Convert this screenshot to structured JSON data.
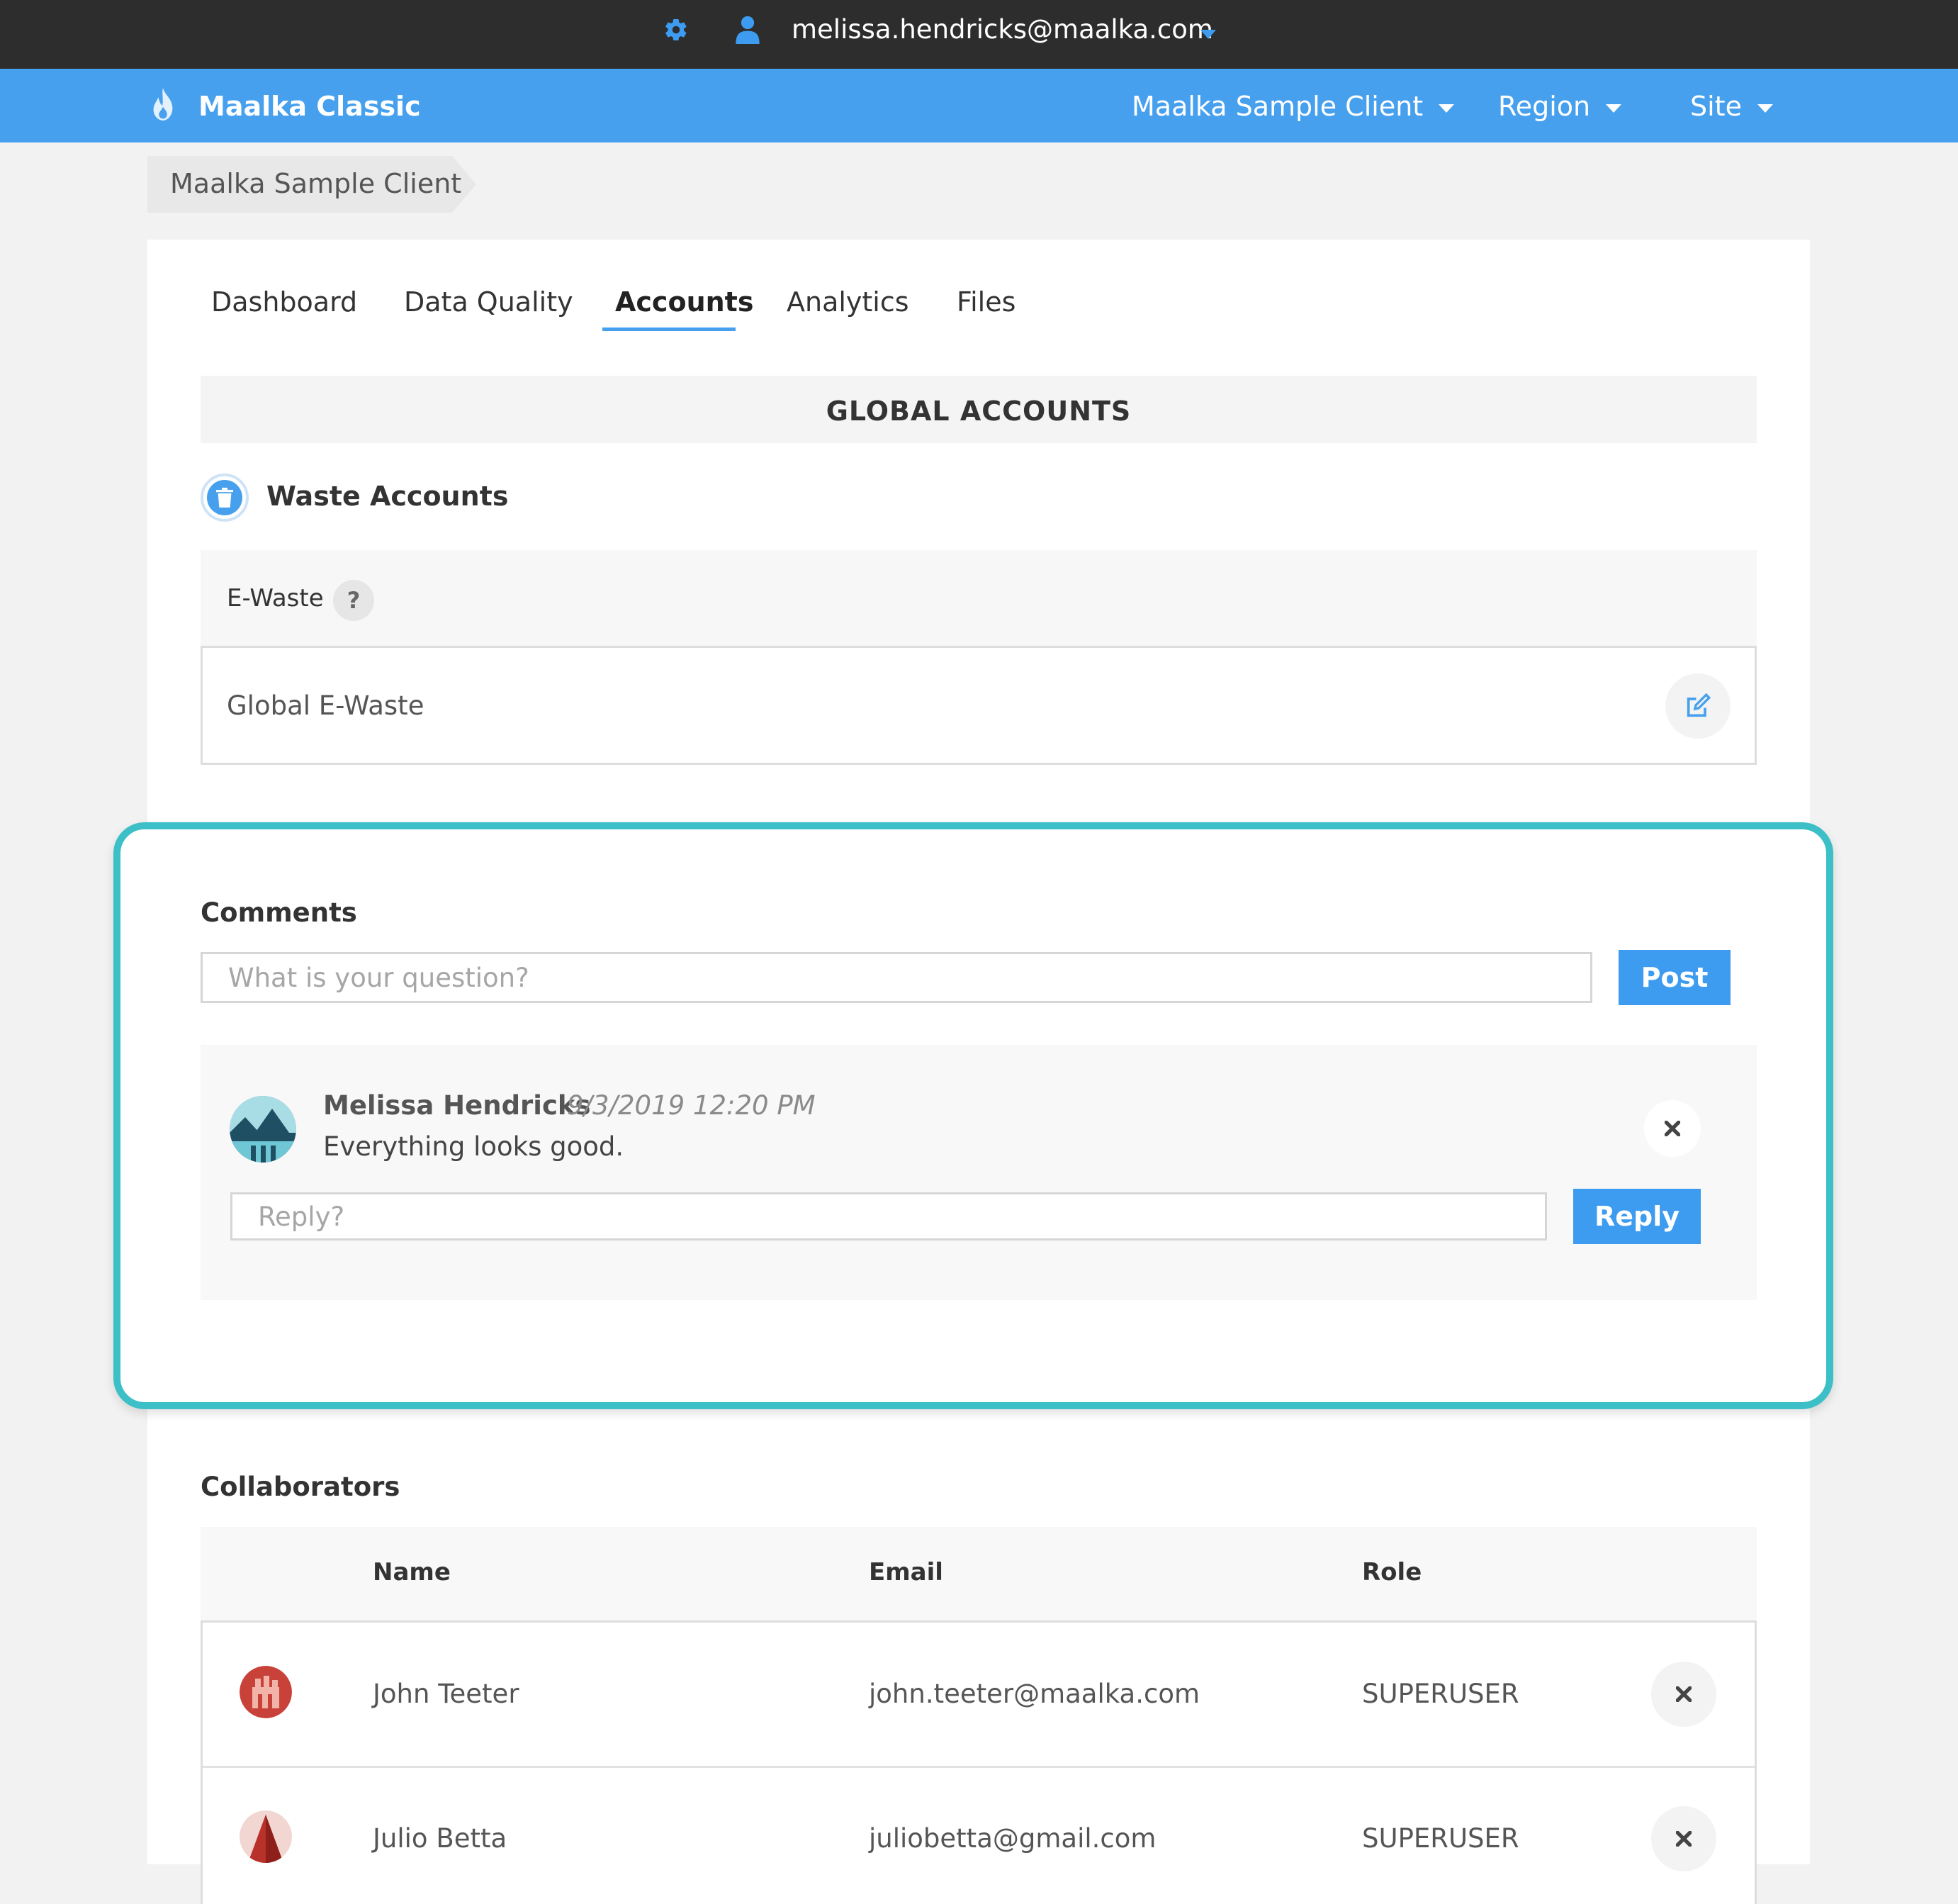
{
  "topbar": {
    "user_email": "melissa.hendricks@maalka.com"
  },
  "appbar": {
    "brand": "Maalka Classic",
    "nav": [
      {
        "label": "Maalka Sample Client"
      },
      {
        "label": "Region"
      },
      {
        "label": "Site"
      }
    ]
  },
  "breadcrumb": {
    "label": "Maalka Sample Client"
  },
  "tabs": [
    {
      "label": "Dashboard",
      "active": false
    },
    {
      "label": "Data Quality",
      "active": false
    },
    {
      "label": "Accounts",
      "active": true
    },
    {
      "label": "Analytics",
      "active": false
    },
    {
      "label": "Files",
      "active": false
    }
  ],
  "global_accounts": {
    "title": "GLOBAL ACCOUNTS",
    "waste_title": "Waste Accounts",
    "ewaste_label": "E-Waste",
    "help_glyph": "?",
    "ewaste_value": "Global E-Waste"
  },
  "comments": {
    "title": "Comments",
    "question_placeholder": "What is your question?",
    "post_label": "Post",
    "items": [
      {
        "author": "Melissa Hendricks",
        "timestamp": "9/3/2019 12:20 PM",
        "text": "Everything looks good.",
        "reply_placeholder": "Reply?",
        "reply_label": "Reply"
      }
    ]
  },
  "collaborators": {
    "title": "Collaborators",
    "columns": [
      "Name",
      "Email",
      "Role"
    ],
    "rows": [
      {
        "name": "John Teeter",
        "email": "john.teeter@maalka.com",
        "role": "SUPERUSER"
      },
      {
        "name": "Julio Betta",
        "email": "juliobetta@gmail.com",
        "role": "SUPERUSER"
      }
    ]
  },
  "colors": {
    "topbar": "#2d2d2d",
    "appbar": "#46a0ee",
    "accent": "#3d9bf0",
    "highlight": "#3cbfc6"
  },
  "icons": {
    "settings": "gear-icon",
    "user": "user-icon",
    "dropdown": "caret-down-icon",
    "brand": "flame-icon",
    "waste": "trash-icon",
    "help": "help-icon",
    "edit": "edit-icon",
    "delete": "close-icon"
  }
}
